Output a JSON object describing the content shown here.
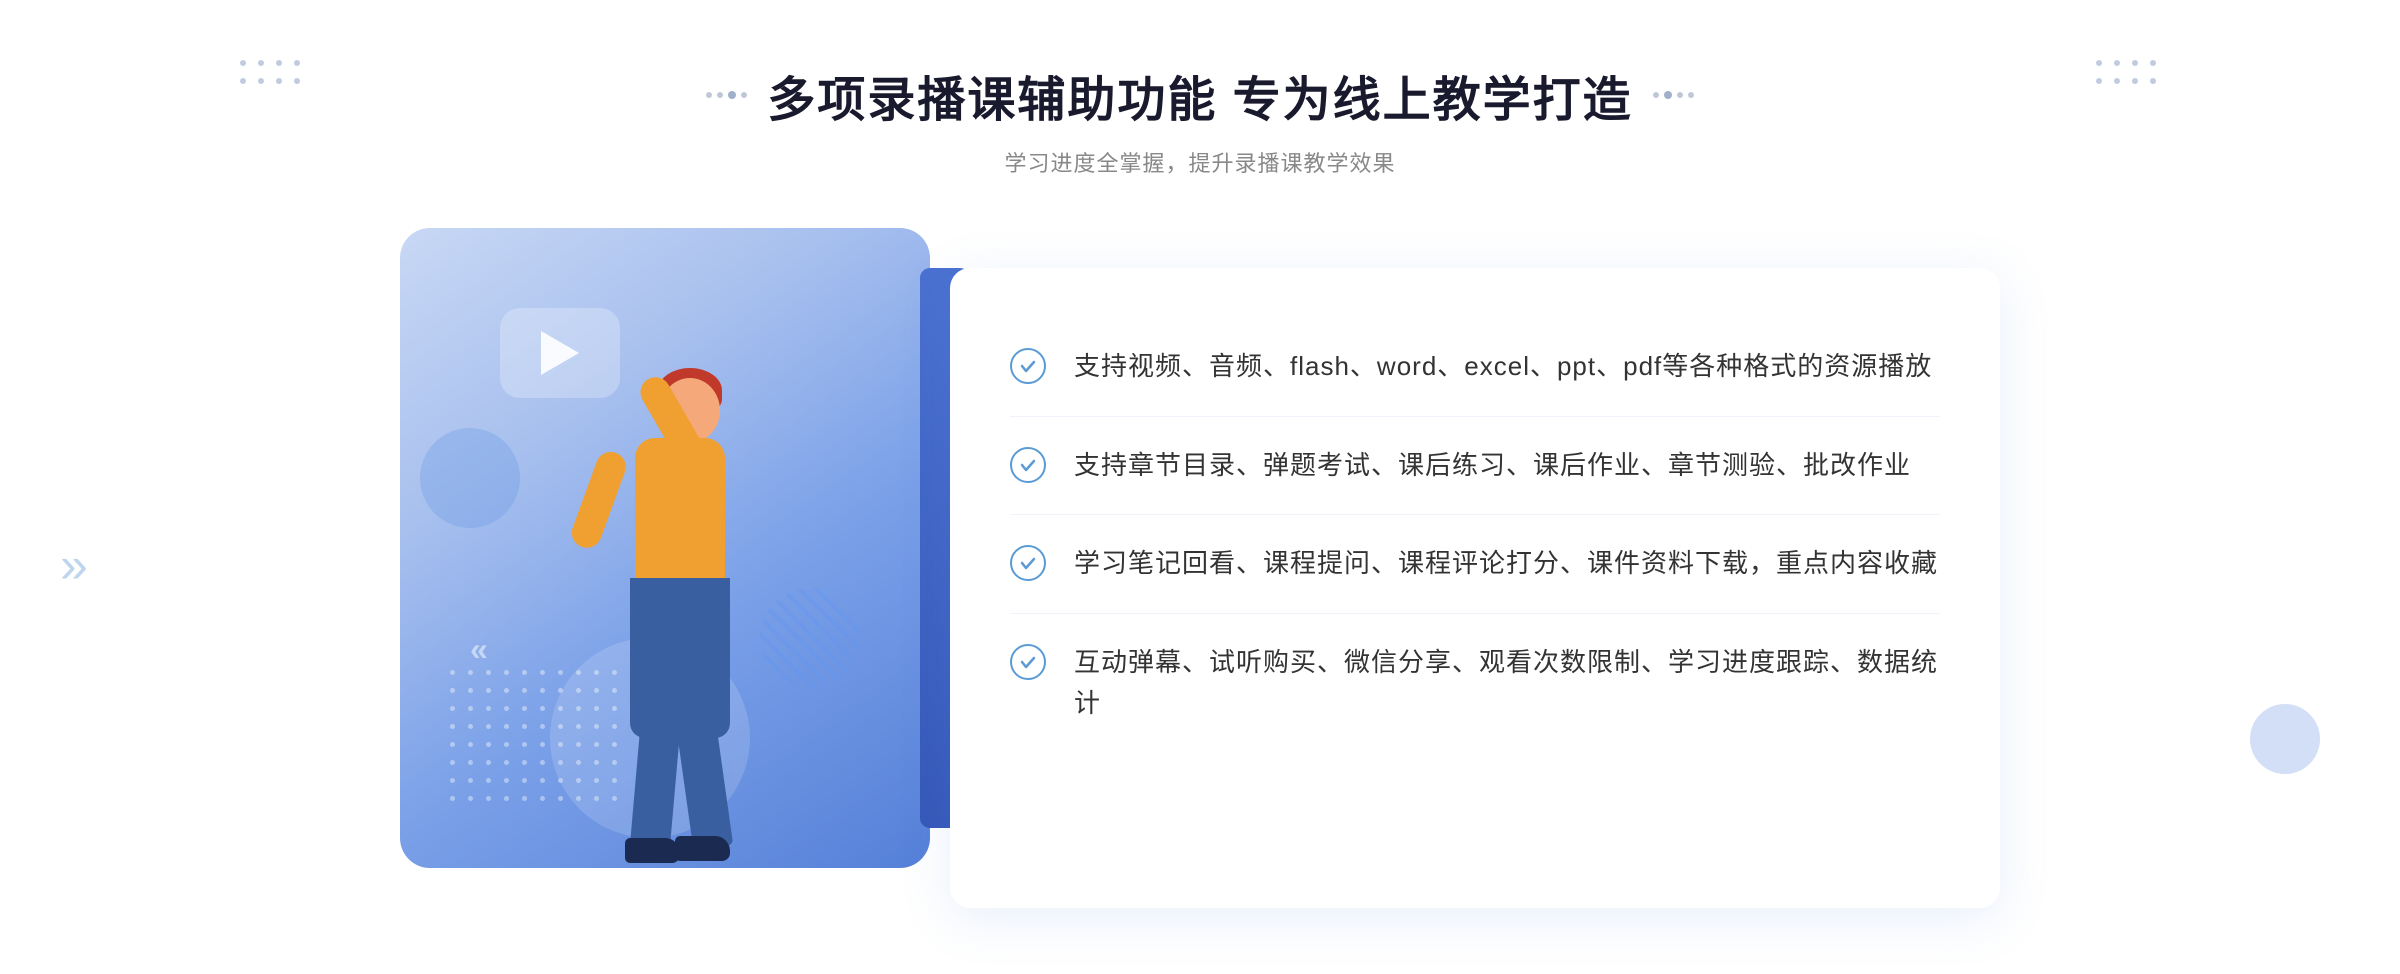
{
  "header": {
    "title": "多项录播课辅助功能 专为线上教学打造",
    "subtitle": "学习进度全掌握，提升录播课教学效果"
  },
  "features": [
    {
      "id": "feature-1",
      "text": "支持视频、音频、flash、word、excel、ppt、pdf等各种格式的资源播放"
    },
    {
      "id": "feature-2",
      "text": "支持章节目录、弹题考试、课后练习、课后作业、章节测验、批改作业"
    },
    {
      "id": "feature-3",
      "text": "学习笔记回看、课程提问、课程评论打分、课件资料下载，重点内容收藏"
    },
    {
      "id": "feature-4",
      "text": "互动弹幕、试听购买、微信分享、观看次数限制、学习进度跟踪、数据统计"
    }
  ],
  "decoration": {
    "chevron_left": "»",
    "play_button_label": "play"
  }
}
